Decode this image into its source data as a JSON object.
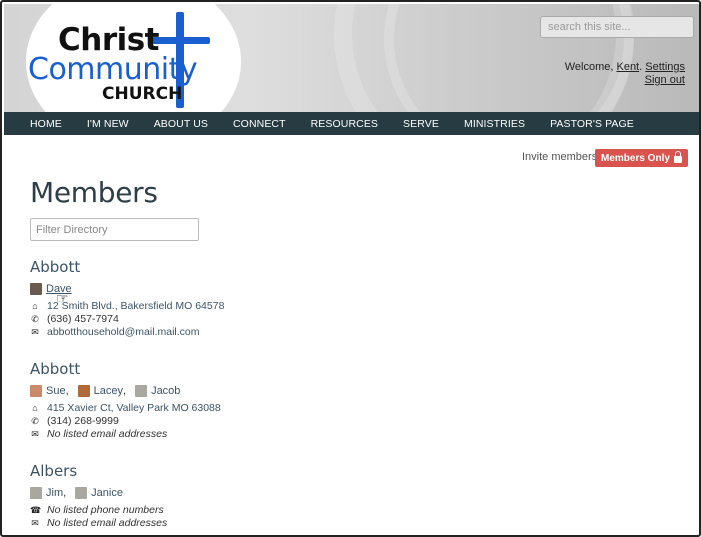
{
  "header": {
    "logo": {
      "line1": "Christ",
      "line2": "Community",
      "line3": "CHURCH"
    },
    "search": {
      "placeholder": "search this site..."
    },
    "welcome_prefix": "Welcome, ",
    "user_name": "Kent",
    "comma": ". ",
    "settings_label": "Settings",
    "signout_label": "Sign out"
  },
  "nav": {
    "items": [
      "HOME",
      "I'M NEW",
      "ABOUT US",
      "CONNECT",
      "RESOURCES",
      "SERVE",
      "MINISTRIES",
      "PASTOR'S PAGE"
    ]
  },
  "actions": {
    "invite_label": "Invite members",
    "members_only_label": "Members Only"
  },
  "page": {
    "title": "Members",
    "filter_placeholder": "Filter Directory"
  },
  "families": [
    {
      "name": "Abbott",
      "members": [
        {
          "name": "Dave",
          "avatar_color": "#6b5a50"
        }
      ],
      "address": "12 Smith Blvd., Bakersfield MO 64578",
      "phone": "(636) 457-7974",
      "email": "abbotthousehold@mail.mail.com"
    },
    {
      "name": "Abbott",
      "members": [
        {
          "name": "Sue",
          "avatar_color": "#c98a6a"
        },
        {
          "name": "Lacey",
          "avatar_color": "#b06a3a"
        },
        {
          "name": "Jacob",
          "avatar_color": "#a8a8a0"
        }
      ],
      "address": "415 Xavier Ct, Valley Park MO 63088",
      "phone": "(314) 268-9999",
      "email_none": "No listed email addresses"
    },
    {
      "name": "Albers",
      "members": [
        {
          "name": "Jim",
          "avatar_color": "#a8a8a0"
        },
        {
          "name": "Janice",
          "avatar_color": "#a8a8a0"
        }
      ],
      "phone_none": "No listed phone numbers",
      "email_none": "No listed email addresses"
    }
  ],
  "separators": {
    "comma": ","
  }
}
